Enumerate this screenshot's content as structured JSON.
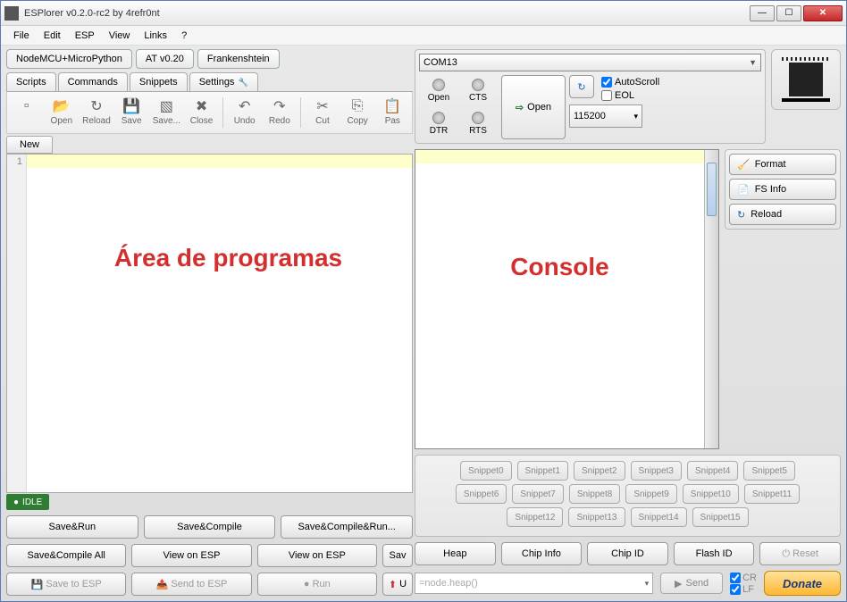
{
  "window": {
    "title": "ESPlorer v0.2.0-rc2 by 4refr0nt"
  },
  "menu": {
    "items": [
      "File",
      "Edit",
      "ESP",
      "View",
      "Links",
      "?"
    ]
  },
  "firmware_tabs": [
    "NodeMCU+MicroPython",
    "AT v0.20",
    "Frankenshtein"
  ],
  "script_tabs": [
    "Scripts",
    "Commands",
    "Snippets",
    "Settings"
  ],
  "toolbar": {
    "items": [
      {
        "label": "",
        "icon": "file-icon"
      },
      {
        "label": "Open",
        "icon": "open-icon",
        "glyph": "📂"
      },
      {
        "label": "Reload",
        "icon": "reload-icon",
        "glyph": "↻"
      },
      {
        "label": "Save",
        "icon": "save-icon",
        "glyph": "💾"
      },
      {
        "label": "Save...",
        "icon": "saveas-icon",
        "glyph": "▧"
      },
      {
        "label": "Close",
        "icon": "close-icon",
        "glyph": "✖"
      },
      {
        "label": "Undo",
        "icon": "undo-icon",
        "glyph": "↶"
      },
      {
        "label": "Redo",
        "icon": "redo-icon",
        "glyph": "↷"
      },
      {
        "label": "Cut",
        "icon": "cut-icon",
        "glyph": "✂"
      },
      {
        "label": "Copy",
        "icon": "copy-icon",
        "glyph": "⎘"
      },
      {
        "label": "Pas",
        "icon": "paste-icon",
        "glyph": "📋"
      }
    ]
  },
  "file_tab": "New",
  "gutter_line": "1",
  "overlay": {
    "left": "Área de programas",
    "right": "Console"
  },
  "status": "IDLE",
  "left_buttons": {
    "row1": [
      "Save&Run",
      "Save&Compile",
      "Save&Compile&Run..."
    ],
    "row2": [
      "Save&Compile All",
      "View on ESP",
      "View on ESP",
      "Sav"
    ],
    "row3": [
      "Save to ESP",
      "Send to ESP",
      "Run",
      "U"
    ]
  },
  "conn": {
    "port": "COM13",
    "leds": {
      "open": "Open",
      "cts": "CTS",
      "dtr": "DTR",
      "rts": "RTS"
    },
    "open_label": "Open",
    "baud": "115200",
    "autoscroll": "AutoScroll",
    "eol": "EOL"
  },
  "side_buttons": [
    {
      "label": "Format",
      "glyph": "🧹"
    },
    {
      "label": "FS Info",
      "glyph": "📄"
    },
    {
      "label": "Reload",
      "glyph": "↻"
    }
  ],
  "snippets": {
    "r1": [
      "Snippet0",
      "Snippet1",
      "Snippet2",
      "Snippet3",
      "Snippet4",
      "Snippet5"
    ],
    "r2": [
      "Snippet6",
      "Snippet7",
      "Snippet8",
      "Snippet9",
      "Snippet10",
      "Snippet11"
    ],
    "r3": [
      "Snippet12",
      "Snippet13",
      "Snippet14",
      "Snippet15"
    ]
  },
  "chip_row": [
    "Heap",
    "Chip Info",
    "Chip ID",
    "Flash ID",
    "Reset"
  ],
  "cmd": {
    "placeholder": "=node.heap()",
    "send": "Send",
    "cr": "CR",
    "lf": "LF"
  },
  "donate": "Donate"
}
